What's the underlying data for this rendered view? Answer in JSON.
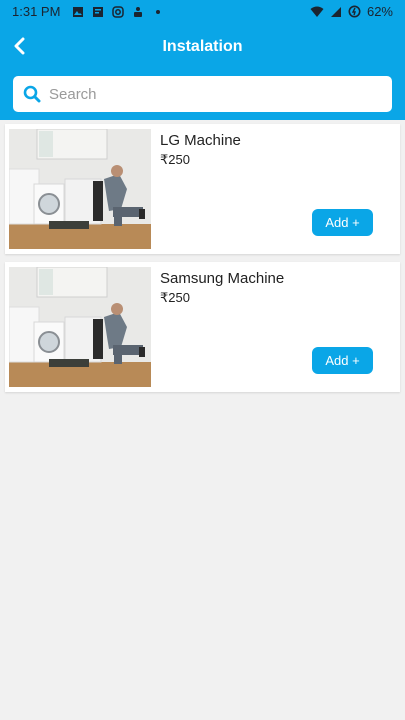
{
  "status_bar": {
    "time": "1:31 PM",
    "battery": "62%",
    "icons_left": [
      "image-icon",
      "news-icon",
      "instagram-icon",
      "podcast-icon",
      "dot-icon"
    ],
    "icons_right": [
      "wifi-icon",
      "signal-icon",
      "battery-saver-icon"
    ]
  },
  "app_bar": {
    "title": "Instalation",
    "back_icon": "chevron-left-icon"
  },
  "search": {
    "placeholder": "Search",
    "icon": "search-icon"
  },
  "products": [
    {
      "name": "LG Machine",
      "price": "₹250",
      "button_label": "Add +"
    },
    {
      "name": "Samsung Machine",
      "price": "₹250",
      "button_label": "Add +"
    }
  ],
  "colors": {
    "primary": "#0aa6e7",
    "background": "#f1f1f1"
  }
}
